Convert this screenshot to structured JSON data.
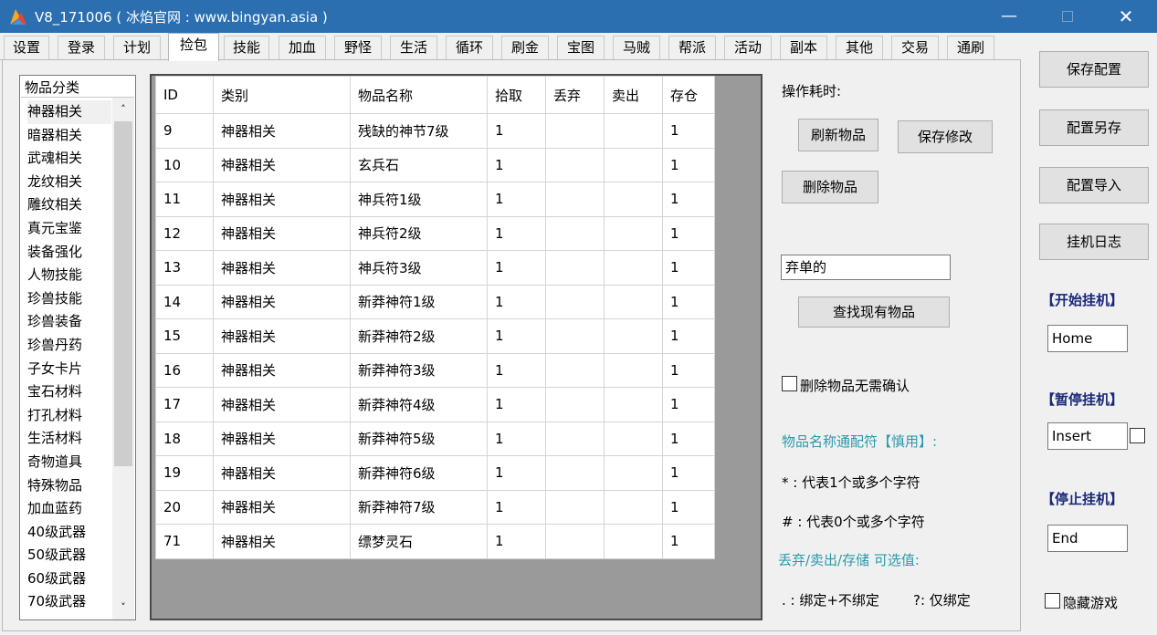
{
  "window": {
    "title": "V8_171006 ( 冰焰官网 : www.bingyan.asia )",
    "minimize": "—",
    "close": "✕"
  },
  "tabs": [
    "设置",
    "登录",
    "计划",
    "捡包",
    "技能",
    "加血",
    "野怪",
    "生活",
    "循环",
    "刷金",
    "宝图",
    "马贼",
    "帮派",
    "活动",
    "副本",
    "其他",
    "交易",
    "通刷"
  ],
  "active_tab": "捡包",
  "category_list": {
    "header": "物品分类",
    "items": [
      "神器相关",
      "暗器相关",
      "武魂相关",
      "龙纹相关",
      "雕纹相关",
      "真元宝鉴",
      "装备强化",
      "人物技能",
      "珍兽技能",
      "珍兽装备",
      "珍兽丹药",
      "子女卡片",
      "宝石材料",
      "打孔材料",
      "生活材料",
      "奇物道具",
      "特殊物品",
      "加血蓝药",
      "40级武器",
      "50级武器",
      "60级武器",
      "70级武器"
    ],
    "selected": "神器相关",
    "scroll_up": "˄",
    "scroll_down": "˅"
  },
  "item_table": {
    "columns": [
      "ID",
      "类别",
      "物品名称",
      "拾取",
      "丢弃",
      "卖出",
      "存仓"
    ],
    "rows": [
      [
        "9",
        "神器相关",
        "残缺的神节7级",
        "1",
        "",
        "",
        "1"
      ],
      [
        "10",
        "神器相关",
        "玄兵石",
        "1",
        "",
        "",
        "1"
      ],
      [
        "11",
        "神器相关",
        "神兵符1级",
        "1",
        "",
        "",
        "1"
      ],
      [
        "12",
        "神器相关",
        "神兵符2级",
        "1",
        "",
        "",
        "1"
      ],
      [
        "13",
        "神器相关",
        "神兵符3级",
        "1",
        "",
        "",
        "1"
      ],
      [
        "14",
        "神器相关",
        "新莽神符1级",
        "1",
        "",
        "",
        "1"
      ],
      [
        "15",
        "神器相关",
        "新莽神符2级",
        "1",
        "",
        "",
        "1"
      ],
      [
        "16",
        "神器相关",
        "新莽神符3级",
        "1",
        "",
        "",
        "1"
      ],
      [
        "17",
        "神器相关",
        "新莽神符4级",
        "1",
        "",
        "",
        "1"
      ],
      [
        "18",
        "神器相关",
        "新莽神符5级",
        "1",
        "",
        "",
        "1"
      ],
      [
        "19",
        "神器相关",
        "新莽神符6级",
        "1",
        "",
        "",
        "1"
      ],
      [
        "20",
        "神器相关",
        "新莽神符7级",
        "1",
        "",
        "",
        "1"
      ],
      [
        "71",
        "神器相关",
        "缥梦灵石",
        "1",
        "",
        "",
        "1"
      ]
    ]
  },
  "ops": {
    "elapsed_label": "操作耗时:",
    "refresh_button": "刷新物品",
    "save_changes_button": "保存修改",
    "delete_button": "删除物品",
    "search_input_value": "弃单的",
    "find_button": "查找现有物品",
    "no_confirm_label": "删除物品无需确认",
    "wildcard_title": "物品名称通配符【慎用】:",
    "wildcard_star": "* : 代表1个或多个字符",
    "wildcard_hash": "# : 代表0个或多个字符",
    "options_title": "丢弃/卖出/存储 可选值:",
    "option_bind_left": ". : 绑定+不绑定",
    "option_bind_right": "?: 仅绑定"
  },
  "right_panel": {
    "save_config": "保存配置",
    "save_as": "配置另存",
    "import_config": "配置导入",
    "hang_log": "挂机日志",
    "start_label": "【开始挂机】",
    "start_key": "Home",
    "pause_label": "【暂停挂机】",
    "pause_key": "Insert",
    "stop_label": "【停止挂机】",
    "stop_key": "End",
    "hide_game": "隐藏游戏"
  },
  "colors": {
    "titlebar": "#2b6fb0",
    "hotkey_label": "#1a2a7a",
    "wildcard_text": "#2a9aaa"
  }
}
